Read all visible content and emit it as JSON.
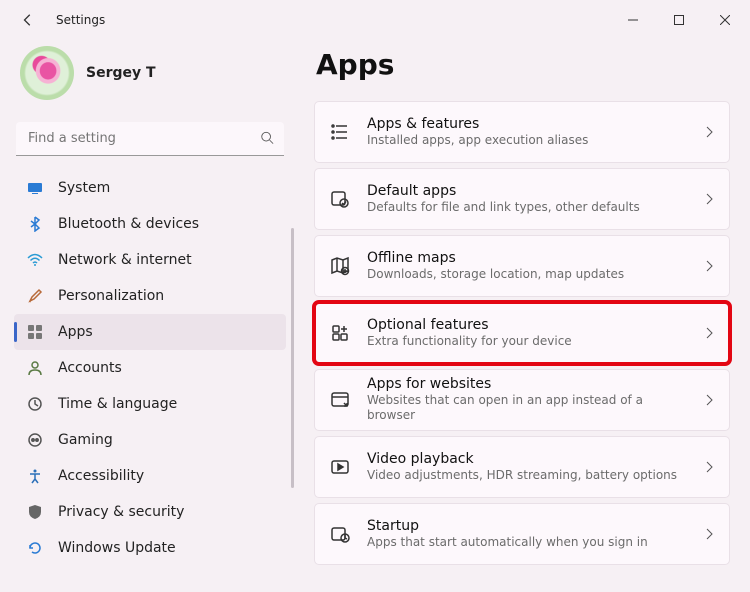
{
  "window": {
    "title": "Settings"
  },
  "user": {
    "name": "Sergey T"
  },
  "search": {
    "placeholder": "Find a setting"
  },
  "sidebar": {
    "items": [
      {
        "label": "System"
      },
      {
        "label": "Bluetooth & devices"
      },
      {
        "label": "Network & internet"
      },
      {
        "label": "Personalization"
      },
      {
        "label": "Apps"
      },
      {
        "label": "Accounts"
      },
      {
        "label": "Time & language"
      },
      {
        "label": "Gaming"
      },
      {
        "label": "Accessibility"
      },
      {
        "label": "Privacy & security"
      },
      {
        "label": "Windows Update"
      }
    ],
    "selected_index": 4
  },
  "main": {
    "heading": "Apps",
    "cards": [
      {
        "title": "Apps & features",
        "subtitle": "Installed apps, app execution aliases"
      },
      {
        "title": "Default apps",
        "subtitle": "Defaults for file and link types, other defaults"
      },
      {
        "title": "Offline maps",
        "subtitle": "Downloads, storage location, map updates"
      },
      {
        "title": "Optional features",
        "subtitle": "Extra functionality for your device"
      },
      {
        "title": "Apps for websites",
        "subtitle": "Websites that can open in an app instead of a browser"
      },
      {
        "title": "Video playback",
        "subtitle": "Video adjustments, HDR streaming, battery options"
      },
      {
        "title": "Startup",
        "subtitle": "Apps that start automatically when you sign in"
      }
    ],
    "highlight_index": 3
  }
}
